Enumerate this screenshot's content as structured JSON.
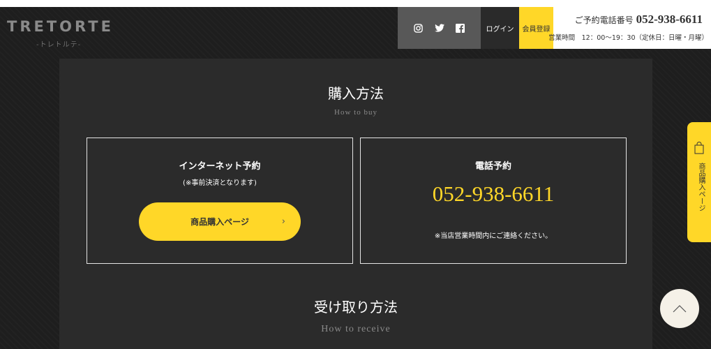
{
  "header": {
    "logo_text": "TRETORTE",
    "logo_sub": "-トレトルテ-",
    "social": [
      {
        "name": "instagram-icon"
      },
      {
        "name": "twitter-icon"
      },
      {
        "name": "facebook-icon"
      }
    ],
    "login_label": "ログイン",
    "register_label": "会員登録",
    "tel_label": "ご予約電話番号",
    "tel_number": "052-938-6611",
    "hours": "営業時間　12：00〜19：30（定休日：日曜・月曜）"
  },
  "purchase": {
    "title": "購入方法",
    "subtitle": "How to buy",
    "internet": {
      "title": "インターネット予約",
      "note": "(※事前決済となります)",
      "button_label": "商品購入ページ"
    },
    "phone": {
      "title": "電話予約",
      "number": "052-938-6611",
      "note": "※当店営業時間内にご連絡ください。"
    }
  },
  "receive": {
    "title": "受け取り方法",
    "subtitle": "How to receive"
  },
  "side_tab": {
    "label": "商品購入ページ"
  },
  "colors": {
    "accent_yellow": "#ffd728",
    "background": "#222222",
    "panel": "#2b2b2b"
  }
}
